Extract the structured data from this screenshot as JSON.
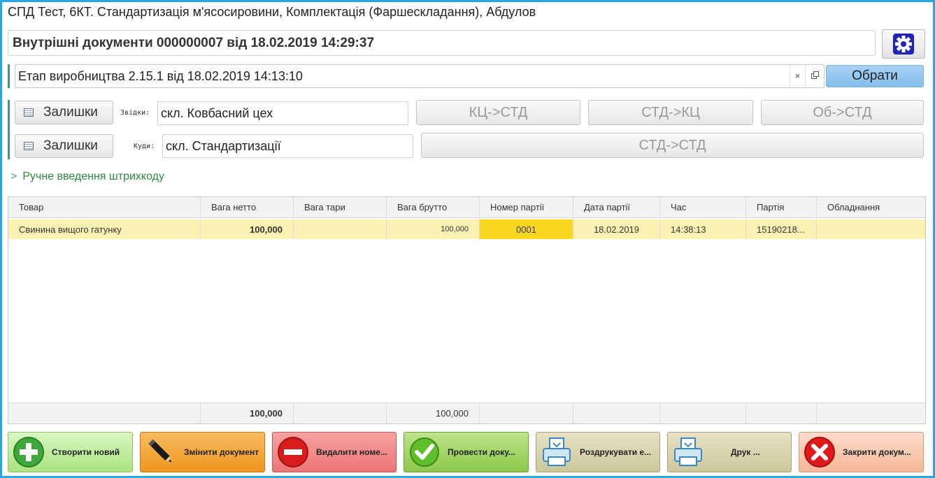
{
  "window_title": "СПД Тест, 6КТ. Стандартизація м'ясосировини, Комплектація (Фаршескладання), Абдулов",
  "document_title": "Внутрішні документи 000000007 від 18.02.2019 14:29:37",
  "stage": {
    "value": "Етап виробництва 2.15.1 від 18.02.2019 14:13:10",
    "clear_symbol": "×",
    "choose_label": "Обрати"
  },
  "from": {
    "remain_label": "Залишки",
    "label": "Звідки:",
    "value": "скл. Ковбасний цех"
  },
  "to": {
    "remain_label": "Залишки",
    "label": "Куди:",
    "value": "скл. Стандартизації"
  },
  "direction_buttons": [
    "КЦ->СТД",
    "СТД->КЦ",
    "Об->СТД",
    "СТД->СТД"
  ],
  "manual_barcode": "Ручне введення штрихкоду",
  "table": {
    "columns": [
      "Товар",
      "Вага нетто",
      "Вага тари",
      "Вага брутто",
      "Номер партії",
      "Дата партії",
      "Час",
      "Партія",
      "Обладнання"
    ],
    "rows": [
      {
        "product": "Свинина вищого гатунку",
        "net": "100,000",
        "tare": "",
        "gross": "100,000",
        "batch_no": "0001",
        "batch_date": "18.02.2019",
        "time": "14:38:13",
        "batch": "15190218...",
        "equipment": ""
      }
    ],
    "totals": {
      "net": "100,000",
      "gross": "100,000"
    }
  },
  "actions": {
    "create": "Створити новий",
    "edit": "Змінити документ",
    "delete": "Видалити номе...",
    "post": "Провести доку...",
    "print_label": "Роздрукувати е...",
    "print": "Друк ...",
    "close": "Закрити докум..."
  },
  "colors": {
    "frame": "#2aa7e0",
    "selected_row": "#fbf1b2",
    "selected_cell": "#fbd81f",
    "create_btn": "#b7ec8f",
    "edit_btn": "#f5a23a",
    "delete_btn": "#f08585",
    "post_btn": "#9fd25a",
    "print_btn": "#d7d2a9",
    "close_btn": "#f8c9b0"
  }
}
